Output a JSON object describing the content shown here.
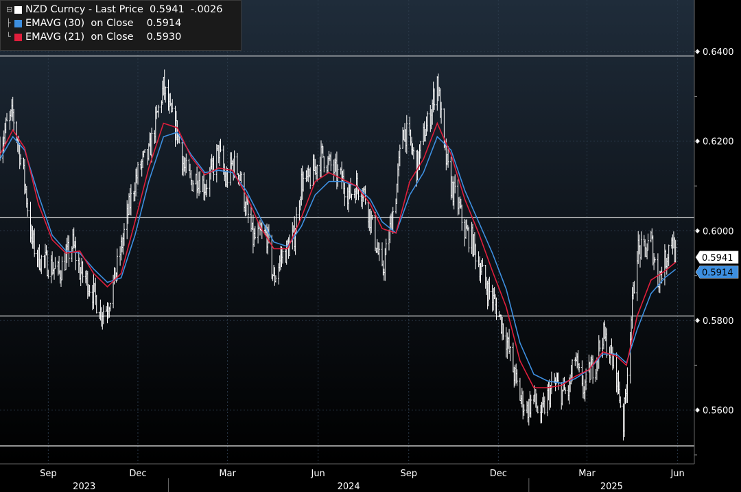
{
  "legend": {
    "main_label": "NZD Curncy - Last Price",
    "main_value": "0.5941",
    "main_change": "-.0026",
    "series": [
      {
        "label": "EMAVG (30)  on Close",
        "value": "0.5914",
        "color": "#3d8fe0"
      },
      {
        "label": "EMAVG (21)  on Close",
        "value": "0.5930",
        "color": "#e01e3c"
      }
    ]
  },
  "colors": {
    "price": "#ffffff",
    "ema30": "#3d8fe0",
    "ema21": "#e01e3c",
    "hline": "#e8e8e8",
    "grid": "#2b3a4a"
  },
  "chart_data": {
    "type": "line",
    "title": "NZD Curncy - Last Price",
    "ylim": [
      0.548,
      0.6515
    ],
    "y_ticks": [
      "0.6400",
      "0.6200",
      "0.6000",
      "0.5800",
      "0.5600"
    ],
    "x_month_ticks": [
      {
        "label": "Sep",
        "date": "2023-09-01"
      },
      {
        "label": "Dec",
        "date": "2023-12-01"
      },
      {
        "label": "Mar",
        "date": "2024-03-01"
      },
      {
        "label": "Jun",
        "date": "2024-06-01"
      },
      {
        "label": "Sep",
        "date": "2024-09-01"
      },
      {
        "label": "Dec",
        "date": "2024-12-01"
      },
      {
        "label": "Mar",
        "date": "2025-03-01"
      },
      {
        "label": "Jun",
        "date": "2025-06-01"
      }
    ],
    "x_year_labels": [
      "2023",
      "2024",
      "2025"
    ],
    "horizontal_lines": [
      0.639,
      0.603,
      0.581,
      0.552
    ],
    "last_price_tag": "0.5941",
    "ema30_tag": "0.5914",
    "series": [
      {
        "name": "NZD Curncy - Last Price",
        "kind": "price",
        "points": [
          [
            "2023-07-14",
            0.619
          ],
          [
            "2023-07-20",
            0.623
          ],
          [
            "2023-07-27",
            0.626
          ],
          [
            "2023-08-01",
            0.62
          ],
          [
            "2023-08-08",
            0.611
          ],
          [
            "2023-08-15",
            0.598
          ],
          [
            "2023-08-22",
            0.594
          ],
          [
            "2023-08-29",
            0.593
          ],
          [
            "2023-09-05",
            0.592
          ],
          [
            "2023-09-12",
            0.5905
          ],
          [
            "2023-09-19",
            0.594
          ],
          [
            "2023-09-26",
            0.597
          ],
          [
            "2023-10-03",
            0.591
          ],
          [
            "2023-10-10",
            0.589
          ],
          [
            "2023-10-17",
            0.586
          ],
          [
            "2023-10-24",
            0.582
          ],
          [
            "2023-10-31",
            0.583
          ],
          [
            "2023-11-07",
            0.589
          ],
          [
            "2023-11-14",
            0.596
          ],
          [
            "2023-11-21",
            0.604
          ],
          [
            "2023-11-28",
            0.611
          ],
          [
            "2023-12-05",
            0.615
          ],
          [
            "2023-12-12",
            0.617
          ],
          [
            "2023-12-19",
            0.624
          ],
          [
            "2023-12-27",
            0.632
          ],
          [
            "2024-01-03",
            0.626
          ],
          [
            "2024-01-10",
            0.622
          ],
          [
            "2024-01-17",
            0.614
          ],
          [
            "2024-01-24",
            0.611
          ],
          [
            "2024-01-31",
            0.612
          ],
          [
            "2024-02-07",
            0.61
          ],
          [
            "2024-02-14",
            0.613
          ],
          [
            "2024-02-21",
            0.618
          ],
          [
            "2024-02-28",
            0.611
          ],
          [
            "2024-03-06",
            0.615
          ],
          [
            "2024-03-13",
            0.613
          ],
          [
            "2024-03-20",
            0.605
          ],
          [
            "2024-03-27",
            0.598
          ],
          [
            "2024-04-03",
            0.599
          ],
          [
            "2024-04-10",
            0.599
          ],
          [
            "2024-04-17",
            0.589
          ],
          [
            "2024-04-24",
            0.594
          ],
          [
            "2024-05-01",
            0.596
          ],
          [
            "2024-05-08",
            0.599
          ],
          [
            "2024-05-15",
            0.611
          ],
          [
            "2024-05-22",
            0.611
          ],
          [
            "2024-05-29",
            0.614
          ],
          [
            "2024-06-05",
            0.617
          ],
          [
            "2024-06-12",
            0.615
          ],
          [
            "2024-06-19",
            0.613
          ],
          [
            "2024-06-26",
            0.611
          ],
          [
            "2024-07-03",
            0.608
          ],
          [
            "2024-07-10",
            0.61
          ],
          [
            "2024-07-17",
            0.609
          ],
          [
            "2024-07-24",
            0.603
          ],
          [
            "2024-07-31",
            0.596
          ],
          [
            "2024-08-05",
            0.59
          ],
          [
            "2024-08-12",
            0.599
          ],
          [
            "2024-08-19",
            0.608
          ],
          [
            "2024-08-26",
            0.623
          ],
          [
            "2024-09-02",
            0.62
          ],
          [
            "2024-09-09",
            0.614
          ],
          [
            "2024-09-16",
            0.621
          ],
          [
            "2024-09-23",
            0.626
          ],
          [
            "2024-09-30",
            0.634
          ],
          [
            "2024-10-07",
            0.618
          ],
          [
            "2024-10-14",
            0.61
          ],
          [
            "2024-10-21",
            0.606
          ],
          [
            "2024-10-28",
            0.6
          ],
          [
            "2024-11-04",
            0.598
          ],
          [
            "2024-11-11",
            0.593
          ],
          [
            "2024-11-18",
            0.588
          ],
          [
            "2024-11-25",
            0.585
          ],
          [
            "2024-12-02",
            0.581
          ],
          [
            "2024-12-09",
            0.576
          ],
          [
            "2024-12-16",
            0.569
          ],
          [
            "2024-12-23",
            0.563
          ],
          [
            "2024-12-30",
            0.56
          ],
          [
            "2025-01-06",
            0.563
          ],
          [
            "2025-01-13",
            0.558
          ],
          [
            "2025-01-20",
            0.563
          ],
          [
            "2025-01-27",
            0.566
          ],
          [
            "2025-02-03",
            0.564
          ],
          [
            "2025-02-10",
            0.564
          ],
          [
            "2025-02-17",
            0.572
          ],
          [
            "2025-02-24",
            0.564
          ],
          [
            "2025-03-03",
            0.568
          ],
          [
            "2025-03-10",
            0.571
          ],
          [
            "2025-03-17",
            0.577
          ],
          [
            "2025-03-24",
            0.573
          ],
          [
            "2025-03-31",
            0.568
          ],
          [
            "2025-04-07",
            0.557
          ],
          [
            "2025-04-14",
            0.578
          ],
          [
            "2025-04-21",
            0.596
          ],
          [
            "2025-04-28",
            0.595
          ],
          [
            "2025-05-05",
            0.598
          ],
          [
            "2025-05-12",
            0.589
          ],
          [
            "2025-05-19",
            0.593
          ],
          [
            "2025-05-26",
            0.599
          ],
          [
            "2025-05-30",
            0.5941
          ]
        ]
      },
      {
        "name": "EMAVG (21) on Close",
        "kind": "ema21",
        "points": [
          [
            "2023-07-14",
            0.617
          ],
          [
            "2023-07-27",
            0.6225
          ],
          [
            "2023-08-08",
            0.6185
          ],
          [
            "2023-08-22",
            0.606
          ],
          [
            "2023-09-05",
            0.598
          ],
          [
            "2023-09-19",
            0.595
          ],
          [
            "2023-10-03",
            0.5955
          ],
          [
            "2023-10-17",
            0.5905
          ],
          [
            "2023-10-31",
            0.5875
          ],
          [
            "2023-11-14",
            0.5905
          ],
          [
            "2023-11-28",
            0.602
          ],
          [
            "2023-12-12",
            0.614
          ],
          [
            "2023-12-27",
            0.624
          ],
          [
            "2024-01-10",
            0.623
          ],
          [
            "2024-01-24",
            0.6165
          ],
          [
            "2024-02-07",
            0.6125
          ],
          [
            "2024-02-21",
            0.614
          ],
          [
            "2024-03-06",
            0.6135
          ],
          [
            "2024-03-20",
            0.608
          ],
          [
            "2024-04-03",
            0.601
          ],
          [
            "2024-04-17",
            0.596
          ],
          [
            "2024-05-01",
            0.596
          ],
          [
            "2024-05-15",
            0.603
          ],
          [
            "2024-05-29",
            0.611
          ],
          [
            "2024-06-12",
            0.613
          ],
          [
            "2024-06-26",
            0.6115
          ],
          [
            "2024-07-10",
            0.61
          ],
          [
            "2024-07-24",
            0.606
          ],
          [
            "2024-08-05",
            0.6005
          ],
          [
            "2024-08-19",
            0.5995
          ],
          [
            "2024-09-02",
            0.611
          ],
          [
            "2024-09-16",
            0.616
          ],
          [
            "2024-09-30",
            0.624
          ],
          [
            "2024-10-14",
            0.617
          ],
          [
            "2024-10-28",
            0.607
          ],
          [
            "2024-11-11",
            0.5995
          ],
          [
            "2024-11-25",
            0.591
          ],
          [
            "2024-12-09",
            0.583
          ],
          [
            "2024-12-23",
            0.571
          ],
          [
            "2025-01-06",
            0.565
          ],
          [
            "2025-01-20",
            0.565
          ],
          [
            "2025-02-03",
            0.5655
          ],
          [
            "2025-02-17",
            0.5675
          ],
          [
            "2025-03-03",
            0.569
          ],
          [
            "2025-03-17",
            0.573
          ],
          [
            "2025-03-31",
            0.572
          ],
          [
            "2025-04-10",
            0.57
          ],
          [
            "2025-04-21",
            0.581
          ],
          [
            "2025-05-05",
            0.589
          ],
          [
            "2025-05-19",
            0.591
          ],
          [
            "2025-05-30",
            0.593
          ]
        ]
      },
      {
        "name": "EMAVG (30) on Close",
        "kind": "ema30",
        "points": [
          [
            "2023-07-14",
            0.616
          ],
          [
            "2023-07-27",
            0.621
          ],
          [
            "2023-08-08",
            0.618
          ],
          [
            "2023-08-22",
            0.608
          ],
          [
            "2023-09-05",
            0.599
          ],
          [
            "2023-09-19",
            0.5955
          ],
          [
            "2023-10-03",
            0.595
          ],
          [
            "2023-10-17",
            0.5915
          ],
          [
            "2023-10-31",
            0.5885
          ],
          [
            "2023-11-14",
            0.5895
          ],
          [
            "2023-11-28",
            0.599
          ],
          [
            "2023-12-12",
            0.611
          ],
          [
            "2023-12-27",
            0.621
          ],
          [
            "2024-01-10",
            0.622
          ],
          [
            "2024-01-24",
            0.617
          ],
          [
            "2024-02-07",
            0.613
          ],
          [
            "2024-02-21",
            0.6135
          ],
          [
            "2024-03-06",
            0.613
          ],
          [
            "2024-03-20",
            0.609
          ],
          [
            "2024-04-03",
            0.603
          ],
          [
            "2024-04-17",
            0.5975
          ],
          [
            "2024-05-01",
            0.5965
          ],
          [
            "2024-05-15",
            0.601
          ],
          [
            "2024-05-29",
            0.608
          ],
          [
            "2024-06-12",
            0.611
          ],
          [
            "2024-06-26",
            0.611
          ],
          [
            "2024-07-10",
            0.61
          ],
          [
            "2024-07-24",
            0.607
          ],
          [
            "2024-08-05",
            0.602
          ],
          [
            "2024-08-19",
            0.5995
          ],
          [
            "2024-09-02",
            0.608
          ],
          [
            "2024-09-16",
            0.613
          ],
          [
            "2024-09-30",
            0.621
          ],
          [
            "2024-10-14",
            0.618
          ],
          [
            "2024-10-28",
            0.609
          ],
          [
            "2024-11-11",
            0.602
          ],
          [
            "2024-11-25",
            0.595
          ],
          [
            "2024-12-09",
            0.587
          ],
          [
            "2024-12-23",
            0.575
          ],
          [
            "2025-01-06",
            0.568
          ],
          [
            "2025-01-20",
            0.5665
          ],
          [
            "2025-02-03",
            0.566
          ],
          [
            "2025-02-17",
            0.567
          ],
          [
            "2025-03-03",
            0.569
          ],
          [
            "2025-03-17",
            0.5725
          ],
          [
            "2025-03-31",
            0.5725
          ],
          [
            "2025-04-10",
            0.5705
          ],
          [
            "2025-04-21",
            0.578
          ],
          [
            "2025-05-05",
            0.586
          ],
          [
            "2025-05-19",
            0.5895
          ],
          [
            "2025-05-30",
            0.5914
          ]
        ]
      }
    ]
  }
}
